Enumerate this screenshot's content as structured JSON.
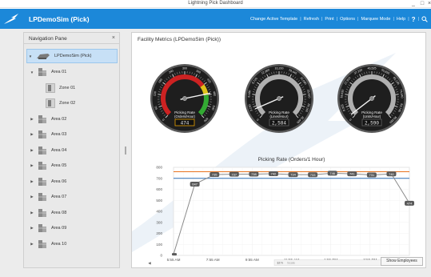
{
  "window": {
    "title": "Lightning Pick Dashboard",
    "minimize": "_",
    "maximize": "□",
    "close": "×"
  },
  "app": {
    "name": "LPDemoSim (Pick)",
    "toolbar": [
      "Change Active Template",
      "Refresh",
      "Print",
      "Options",
      "Marquee Mode",
      "Help"
    ],
    "help_symbol": "?",
    "search_icon": "search-icon"
  },
  "nav": {
    "title": "Navigation Pane",
    "close": "×",
    "root": {
      "label": "LPDemoSim (Pick)",
      "expander": "▼"
    },
    "items": [
      {
        "label": "Area 01",
        "expander": "▼",
        "level": 1
      },
      {
        "label": "Zone 01",
        "expander": "",
        "level": 2
      },
      {
        "label": "Zone 02",
        "expander": "",
        "level": 2
      },
      {
        "label": "Area 02",
        "expander": "▶",
        "level": 1
      },
      {
        "label": "Area 03",
        "expander": "▶",
        "level": 1
      },
      {
        "label": "Area 04",
        "expander": "▶",
        "level": 1
      },
      {
        "label": "Area 05",
        "expander": "▶",
        "level": 1
      },
      {
        "label": "Area 06",
        "expander": "▶",
        "level": 1
      },
      {
        "label": "Area 07",
        "expander": "▶",
        "level": 1
      },
      {
        "label": "Area 08",
        "expander": "▶",
        "level": 1
      },
      {
        "label": "Area 09",
        "expander": "▶",
        "level": 1
      },
      {
        "label": "Area 10",
        "expander": "▶",
        "level": 1
      }
    ]
  },
  "main": {
    "title": "Facility Metrics (LPDemoSim (Pick))",
    "show_employees": "Show Employees"
  },
  "gauges": [
    {
      "name": "Picking Rate",
      "unit": "(Orders/Hour)",
      "readout": "474",
      "value": 474,
      "min": 0,
      "max": 600,
      "ticks": [
        "0",
        "60",
        "120",
        "180",
        "240",
        "300",
        "360",
        "420",
        "480",
        "540",
        "600"
      ],
      "bands": [
        {
          "from": 0,
          "to": 420,
          "color": "#cc2222"
        },
        {
          "from": 420,
          "to": 480,
          "color": "#e0c21a"
        },
        {
          "from": 480,
          "to": 600,
          "color": "#33aa33"
        }
      ],
      "readout_border": "#e8a000"
    },
    {
      "name": "Picking Rate",
      "unit": "(Lines/Hour)",
      "readout": "2,584",
      "value": 2584,
      "min": 0,
      "max": 32400,
      "ticks": [
        "0",
        "3,240",
        "6,480",
        "9,720",
        "12,960",
        "16,200",
        "19,440",
        "22,680",
        "25,920",
        "29,160",
        "32,400"
      ],
      "bands": [],
      "readout_border": "#666666"
    },
    {
      "name": "Picking Rate",
      "unit": "(Units/Hour)",
      "readout": "2,590",
      "value": 2590,
      "min": 0,
      "max": 93050,
      "ticks": [
        "0",
        "9,305",
        "18,610",
        "27,915",
        "37,220",
        "46,525",
        "55,830",
        "65,135",
        "74,440",
        "83,745",
        "93,050"
      ],
      "bands": [],
      "readout_border": "#666666"
    }
  ],
  "chart_data": {
    "type": "line",
    "title": "Picking Rate (Orders/1 Hour)",
    "xlabel": "",
    "ylabel": "",
    "x_ticks": [
      "5:55 AM",
      "7:55 AM",
      "9:55 AM",
      "11:55 AM",
      "1:55 PM",
      "3:55 PM",
      "5:55 PM"
    ],
    "y_ticks": [
      "0",
      "100",
      "200",
      "300",
      "400",
      "500",
      "600",
      "700",
      "800"
    ],
    "ylim": [
      0,
      800
    ],
    "xlim_hours": [
      5.9167,
      17.9167
    ],
    "series": [
      {
        "color": "#8a8a8a",
        "points": [
          {
            "t": 5.9167,
            "y": 10,
            "label": ""
          },
          {
            "t": 7.0,
            "y": 647,
            "label": "647"
          },
          {
            "t": 8.0,
            "y": 735,
            "label": "735"
          },
          {
            "t": 9.0,
            "y": 737,
            "label": "737"
          },
          {
            "t": 10.0,
            "y": 738,
            "label": "738"
          },
          {
            "t": 11.0,
            "y": 742,
            "label": "742"
          },
          {
            "t": 12.0,
            "y": 734,
            "label": "734"
          },
          {
            "t": 13.0,
            "y": 733,
            "label": "733"
          },
          {
            "t": 14.0,
            "y": 746,
            "label": "746"
          },
          {
            "t": 15.0,
            "y": 741,
            "label": "741"
          },
          {
            "t": 16.0,
            "y": 731,
            "label": "731"
          },
          {
            "t": 17.0,
            "y": 740,
            "label": "740"
          },
          {
            "t": 17.9167,
            "y": 474,
            "label": "474"
          }
        ]
      }
    ],
    "reference_lines": [
      {
        "y": 760,
        "color": "#e8731f"
      },
      {
        "y": 700,
        "color": "#2f6fb5"
      }
    ],
    "scrollbar": {
      "left_arrow": "◀",
      "right_arrow": "▶",
      "label": "12 h",
      "sublabel": "Scale"
    }
  }
}
